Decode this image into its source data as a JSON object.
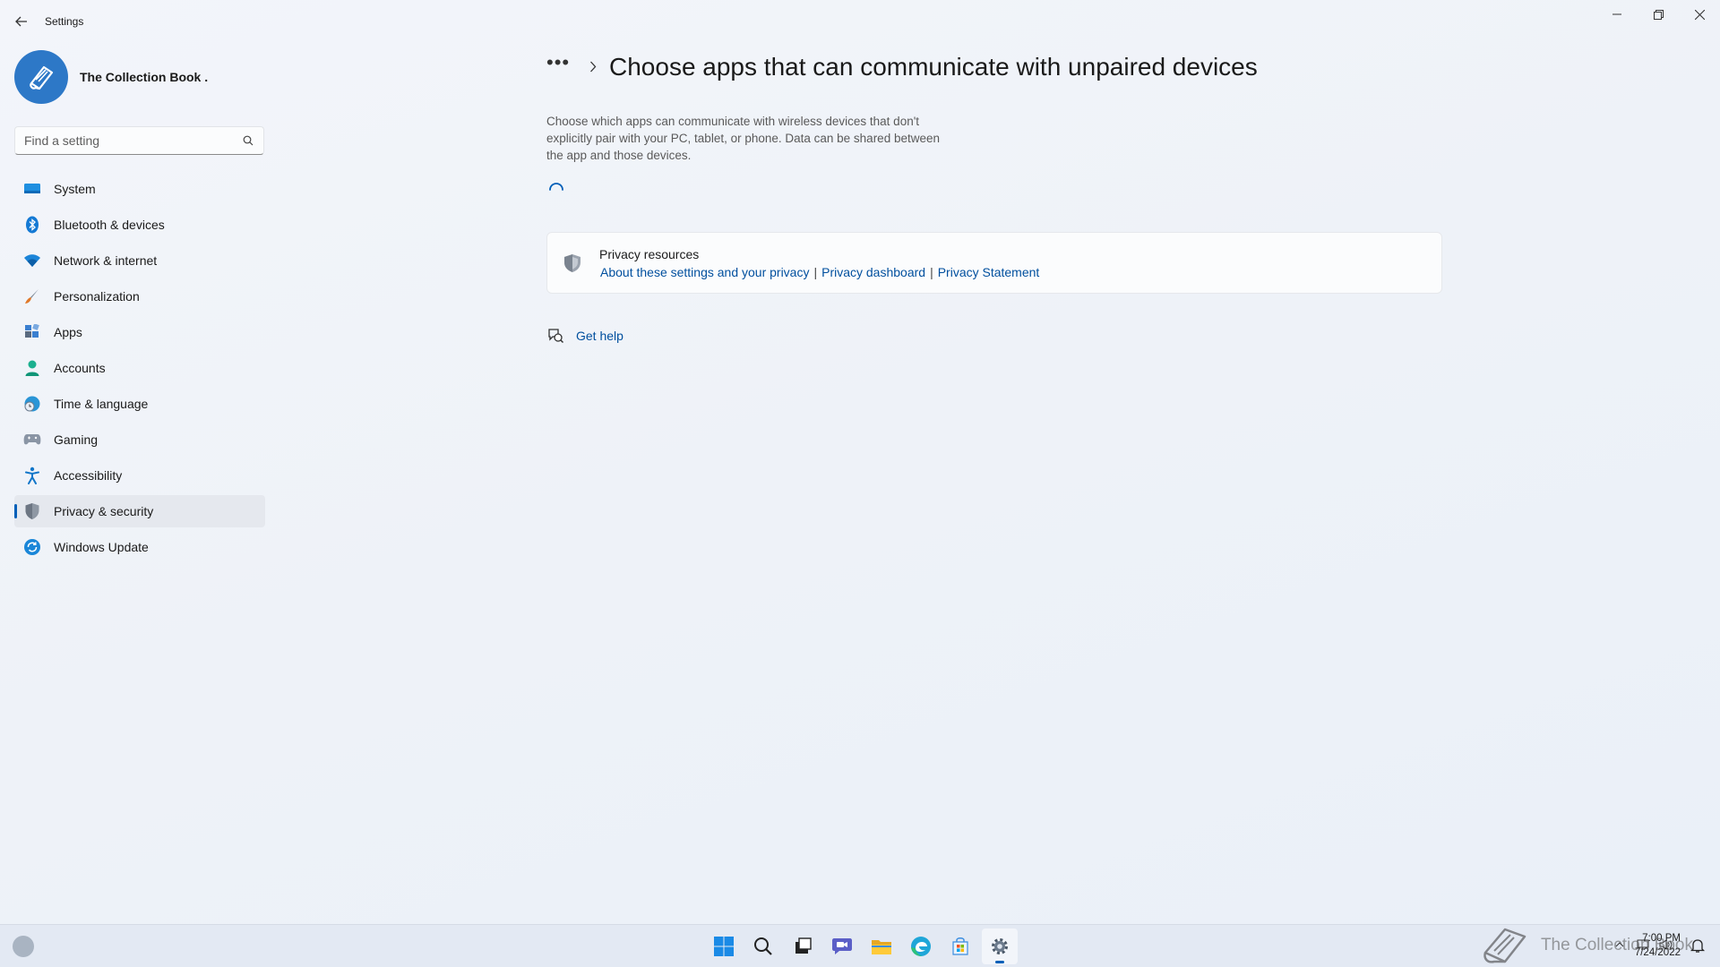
{
  "window": {
    "app_title": "Settings",
    "controls": {
      "minimize": "—",
      "restore": "❐",
      "close": "✕"
    }
  },
  "profile": {
    "name": "The Collection Book ."
  },
  "search": {
    "placeholder": "Find a setting"
  },
  "sidebar": {
    "items": [
      {
        "label": "System",
        "icon": "system-icon"
      },
      {
        "label": "Bluetooth & devices",
        "icon": "bluetooth-icon"
      },
      {
        "label": "Network & internet",
        "icon": "wifi-icon"
      },
      {
        "label": "Personalization",
        "icon": "brush-icon"
      },
      {
        "label": "Apps",
        "icon": "apps-icon"
      },
      {
        "label": "Accounts",
        "icon": "person-icon"
      },
      {
        "label": "Time & language",
        "icon": "globe-clock-icon"
      },
      {
        "label": "Gaming",
        "icon": "gamepad-icon"
      },
      {
        "label": "Accessibility",
        "icon": "accessibility-icon"
      },
      {
        "label": "Privacy & security",
        "icon": "shield-icon",
        "active": true
      },
      {
        "label": "Windows Update",
        "icon": "update-icon"
      }
    ]
  },
  "main": {
    "breadcrumb_more": "•••",
    "title": "Choose apps that can communicate with unpaired devices",
    "description": "Choose which apps can communicate with wireless devices that don't explicitly pair with your PC, tablet, or phone. Data can be shared between the app and those devices.",
    "privacy_resources": {
      "title": "Privacy resources",
      "links": [
        "About these settings and your privacy",
        "Privacy dashboard",
        "Privacy Statement"
      ],
      "separator": "|"
    },
    "get_help": "Get help"
  },
  "taskbar": {
    "apps": [
      "start-icon",
      "search-icon",
      "task-view-icon",
      "chat-icon",
      "file-explorer-icon",
      "edge-icon",
      "store-icon",
      "settings-icon"
    ],
    "clock": {
      "time": "7:00 PM",
      "date": "7/24/2022"
    },
    "watermark": "The Collection Book"
  },
  "colors": {
    "accent": "#005fb8",
    "link": "#004f9e",
    "background": "#eef2f8"
  }
}
